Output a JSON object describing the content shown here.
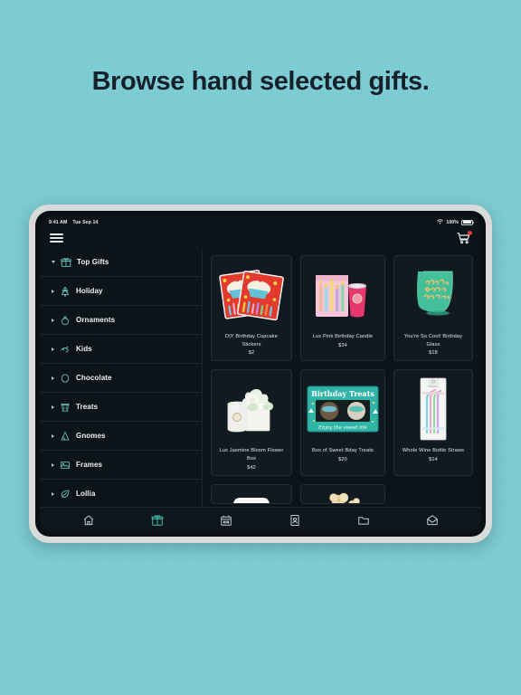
{
  "headline": "Browse hand selected gifts.",
  "colors": {
    "page_background": "#7ccdd4",
    "headline_text": "#16212b",
    "screen_background": "#0d1419",
    "accent_teal": "#6fd4cd",
    "active_tab": "#3fbfae",
    "cart_badge": "#e03a2f"
  },
  "status_bar": {
    "time": "9:41 AM",
    "date": "Tue Sep 14",
    "battery_percent": "100%",
    "wifi_icon": "wifi-icon",
    "battery_icon": "battery-icon"
  },
  "app_bar": {
    "menu_icon": "hamburger-menu-icon",
    "cart_icon": "shopping-cart-icon",
    "cart_has_badge": true
  },
  "sidebar": {
    "items": [
      {
        "label": "Top Gifts",
        "icon": "gift-icon",
        "expanded": true
      },
      {
        "label": "Holiday",
        "icon": "tree-icon",
        "expanded": false
      },
      {
        "label": "Ornaments",
        "icon": "ornament-icon",
        "expanded": false
      },
      {
        "label": "Kids",
        "icon": "kids-icon",
        "expanded": false
      },
      {
        "label": "Chocolate",
        "icon": "cocoa-icon",
        "expanded": false
      },
      {
        "label": "Treats",
        "icon": "treats-icon",
        "expanded": false
      },
      {
        "label": "Gnomes",
        "icon": "gnome-icon",
        "expanded": false
      },
      {
        "label": "Frames",
        "icon": "frame-icon",
        "expanded": false
      },
      {
        "label": "Lollia",
        "icon": "leaf-icon",
        "expanded": false
      }
    ]
  },
  "products": [
    {
      "title": "DIY Birthday Cupcake Stickers",
      "price": "$2",
      "image": "sticker-sheet-image"
    },
    {
      "title": "Lux Pink Birthday Candle",
      "price": "$34",
      "image": "pink-candle-image"
    },
    {
      "title": "You're So Cool! Birthday Glass",
      "price": "$18",
      "image": "green-wine-glass-image"
    },
    {
      "title": "Lux Jasmine Bloom Flower Box",
      "price": "$42",
      "image": "flower-box-candle-image"
    },
    {
      "title": "Box of Sweet Bday Treats",
      "price": "$20",
      "image": "treats-box-image"
    },
    {
      "title": "Whole Wine Bottle Straws",
      "price": "$14",
      "image": "wine-straws-image"
    }
  ],
  "tab_bar": {
    "tabs": [
      {
        "icon": "home-icon",
        "active": false
      },
      {
        "icon": "gift-icon",
        "active": true
      },
      {
        "icon": "calendar-icon",
        "active": false
      },
      {
        "icon": "contact-icon",
        "active": false
      },
      {
        "icon": "folder-icon",
        "active": false
      },
      {
        "icon": "mail-icon",
        "active": false
      }
    ]
  }
}
